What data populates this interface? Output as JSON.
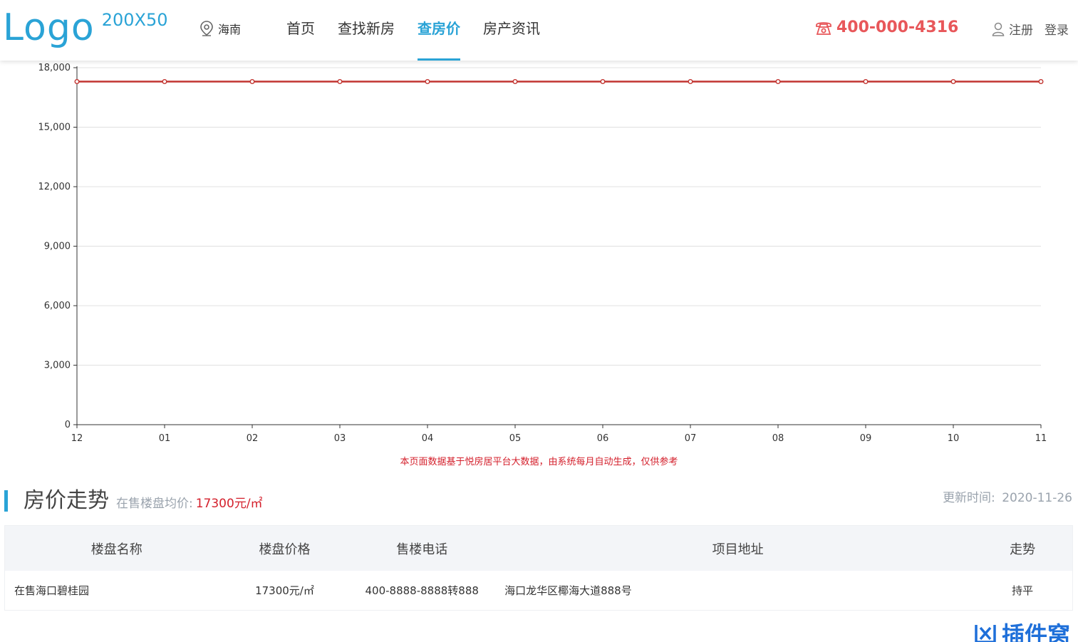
{
  "header": {
    "logo_main": "Logo",
    "logo_sub": "200X50",
    "city": "海南",
    "nav": [
      {
        "label": "首页",
        "active": false
      },
      {
        "label": "查找新房",
        "active": false
      },
      {
        "label": "查房价",
        "active": true
      },
      {
        "label": "房产资讯",
        "active": false
      }
    ],
    "phone": "400-000-4316",
    "register": "注册",
    "login": "登录",
    "icons": {
      "city": "location-pin-icon",
      "phone": "telephone-icon",
      "user": "user-icon"
    }
  },
  "chart_data": {
    "type": "line",
    "categories": [
      "12",
      "01",
      "02",
      "03",
      "04",
      "05",
      "06",
      "07",
      "08",
      "09",
      "10",
      "11"
    ],
    "series": [
      {
        "values": [
          17300,
          17300,
          17300,
          17300,
          17300,
          17300,
          17300,
          17300,
          17300,
          17300,
          17300,
          17300
        ],
        "color": "#c23531"
      }
    ],
    "y_ticks": [
      "0",
      "3,000",
      "6,000",
      "9,000",
      "12,000",
      "15,000",
      "18,000"
    ],
    "ylim": [
      0,
      18000
    ],
    "grid": true,
    "title": "",
    "xlabel": "",
    "ylabel": ""
  },
  "note": "本页面数据基于悦房居平台大数据，由系统每月自动生成，仅供参考",
  "section": {
    "title": "房价走势",
    "avg_label": "在售楼盘均价:",
    "avg_value": "17300元/㎡",
    "update_label": "更新时间:",
    "update_value": "2020-11-26"
  },
  "table": {
    "headers": [
      "楼盘名称",
      "楼盘价格",
      "售楼电话",
      "项目地址",
      "走势"
    ],
    "rows": [
      [
        "在售海口碧桂园",
        "17300元/㎡",
        "400-8888-8888转888",
        "海口龙华区椰海大道888号",
        "持平"
      ]
    ]
  },
  "watermark": "插件窝",
  "colors": {
    "accent": "#2aa3d6",
    "phone": "#e8575a",
    "line": "#c23531",
    "note": "#d4202c"
  }
}
